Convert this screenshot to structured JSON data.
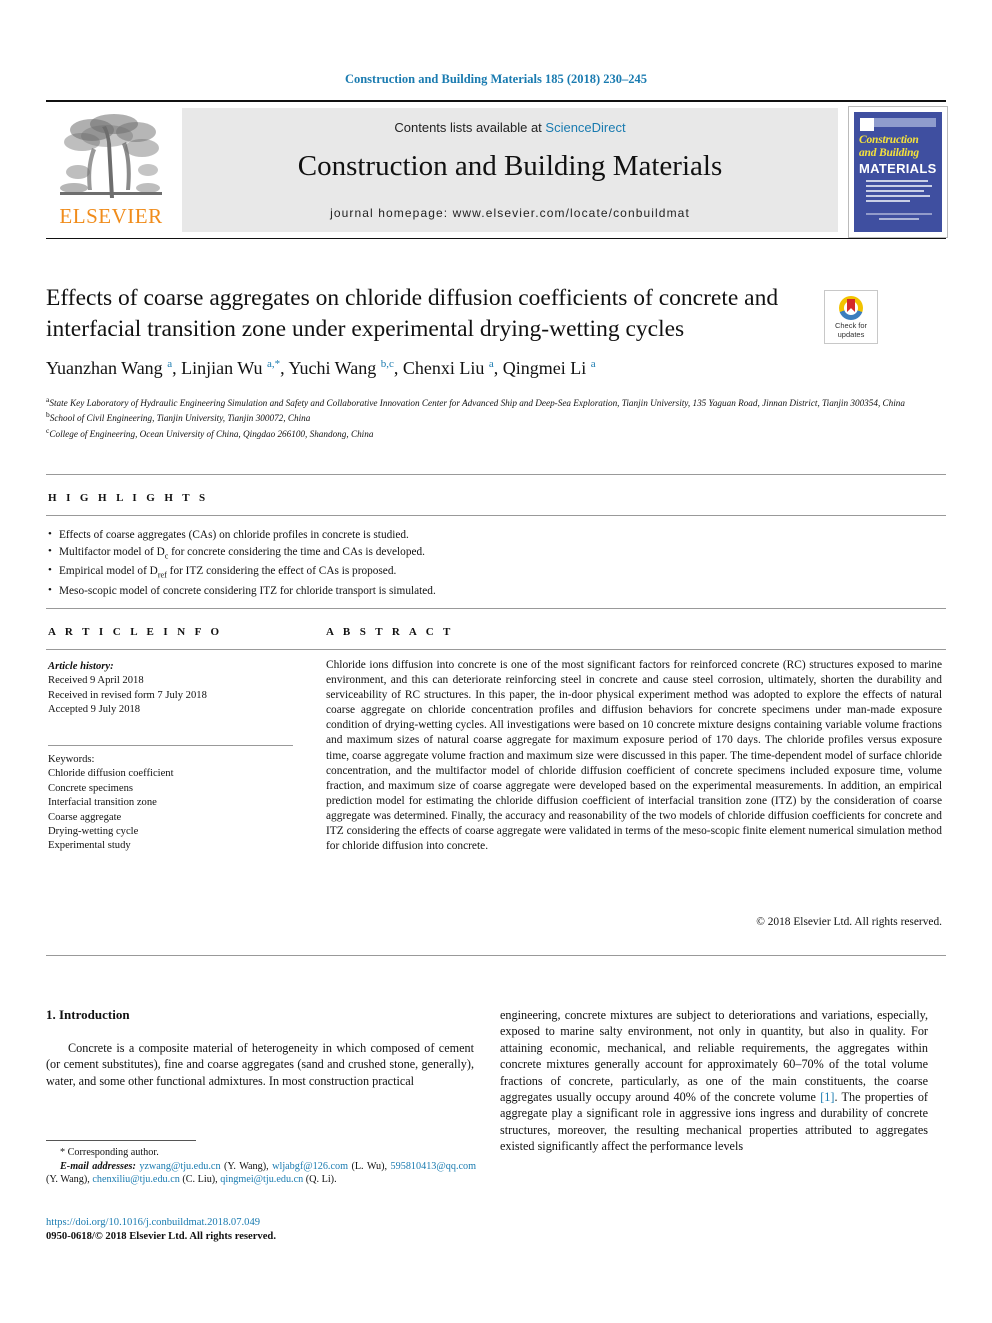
{
  "running_head": "Construction and Building Materials 185 (2018) 230–245",
  "masthead": {
    "publisher": "ELSEVIER",
    "contents_prefix": "Contents lists available at ",
    "contents_link": "ScienceDirect",
    "journal_title": "Construction and Building Materials",
    "homepage": "journal homepage: www.elsevier.com/locate/conbuildmat",
    "cover": {
      "line1": "Construction",
      "line2": "and Building",
      "line3": "MATERIALS"
    }
  },
  "article": {
    "title": "Effects of coarse aggregates on chloride diffusion coefficients of concrete and interfacial transition zone under experimental drying-wetting cycles",
    "authors_html": "Yuanzhan Wang <sup>a</sup>, Linjian Wu <sup>a,*</sup>, Yuchi Wang <sup>b,c</sup>, Chenxi Liu <sup>a</sup>, Qingmei Li <sup>a</sup>",
    "affiliations": [
      {
        "label": "a",
        "text": "State Key Laboratory of Hydraulic Engineering Simulation and Safety and Collaborative Innovation Center for Advanced Ship and Deep-Sea Exploration, Tianjin University, 135 Yaguan Road, Jinnan District, Tianjin 300354, China"
      },
      {
        "label": "b",
        "text": "School of Civil Engineering, Tianjin University, Tianjin 300072, China"
      },
      {
        "label": "c",
        "text": "College of Engineering, Ocean University of China, Qingdao 266100, Shandong, China"
      }
    ],
    "crossmark": {
      "line1": "Check for",
      "line2": "updates"
    }
  },
  "highlights": {
    "heading": "H I G H L I G H T S",
    "items_html": [
      "Effects of coarse aggregates (CAs) on chloride profiles in concrete is studied.",
      "Multifactor model of D<sub>c</sub> for concrete considering the time and CAs is developed.",
      "Empirical model of D<sub>ref</sub> for ITZ considering the effect of CAs is proposed.",
      "Meso-scopic model of concrete considering ITZ for chloride transport is simulated."
    ]
  },
  "article_info": {
    "heading": "A R T I C L E   I N F O",
    "history_label": "Article history:",
    "history": [
      "Received 9 April 2018",
      "Received in revised form 7 July 2018",
      "Accepted 9 July 2018"
    ],
    "keywords_label": "Keywords:",
    "keywords": [
      "Chloride diffusion coefficient",
      "Concrete specimens",
      "Interfacial transition zone",
      "Coarse aggregate",
      "Drying-wetting cycle",
      "Experimental study"
    ]
  },
  "abstract": {
    "heading": "A B S T R A C T",
    "text": "Chloride ions diffusion into concrete is one of the most significant factors for reinforced concrete (RC) structures exposed to marine environment, and this can deteriorate reinforcing steel in concrete and cause steel corrosion, ultimately, shorten the durability and serviceability of RC structures. In this paper, the in-door physical experiment method was adopted to explore the effects of natural coarse aggregate on chloride concentration profiles and diffusion behaviors for concrete specimens under man-made exposure condition of drying-wetting cycles. All investigations were based on 10 concrete mixture designs containing variable volume fractions and maximum sizes of natural coarse aggregate for maximum exposure period of 170 days. The chloride profiles versus exposure time, coarse aggregate volume fraction and maximum size were discussed in this paper. The time-dependent model of surface chloride concentration, and the multifactor model of chloride diffusion coefficient of concrete specimens included exposure time, volume fraction, and maximum size of coarse aggregate were developed based on the experimental measurements. In addition, an empirical prediction model for estimating the chloride diffusion coefficient of interfacial transition zone (ITZ) by the consideration of coarse aggregate was determined. Finally, the accuracy and reasonability of the two models of chloride diffusion coefficients for concrete and ITZ considering the effects of coarse aggregate were validated in terms of the meso-scopic finite element numerical simulation method for chloride diffusion into concrete.",
    "copyright": "© 2018 Elsevier Ltd. All rights reserved."
  },
  "body": {
    "section_heading": "1. Introduction",
    "left_paragraph": "Concrete is a composite material of heterogeneity in which composed of cement (or cement substitutes), fine and coarse aggregates (sand and crushed stone, generally), water, and some other functional admixtures. In most construction practical",
    "right_paragraph_pre": "engineering, concrete mixtures are subject to deteriorations and variations, especially, exposed to marine salty environment, not only in quantity, but also in quality. For attaining economic, mechanical, and reliable requirements, the aggregates within concrete mixtures generally account for approximately 60–70% of the total volume fractions of concrete, particularly, as one of the main constituents, the coarse aggregates usually occupy around 40% of the concrete volume ",
    "right_ref": "[1]",
    "right_paragraph_post": ". The properties of aggregate play a significant role in aggressive ions ingress and durability of concrete structures, moreover, the resulting mechanical properties attributed to aggregates existed significantly affect the performance levels"
  },
  "footnotes": {
    "corresponding": "* Corresponding author.",
    "email_label": "E-mail addresses:",
    "emails": [
      {
        "addr": "yzwang@tju.edu.cn",
        "who": "(Y. Wang),"
      },
      {
        "addr": "wljabgf@126.com",
        "who": "(L. Wu),"
      },
      {
        "addr": "595810413@qq.com",
        "who": "(Y. Wang),"
      },
      {
        "addr": "chenxiliu@tju.edu.cn",
        "who": "(C. Liu),"
      },
      {
        "addr": "qingmei@tju.edu.cn",
        "who": "(Q. Li)."
      }
    ],
    "doi": "https://doi.org/10.1016/j.conbuildmat.2018.07.049",
    "issn": "0950-0618/© 2018 Elsevier Ltd. All rights reserved."
  }
}
